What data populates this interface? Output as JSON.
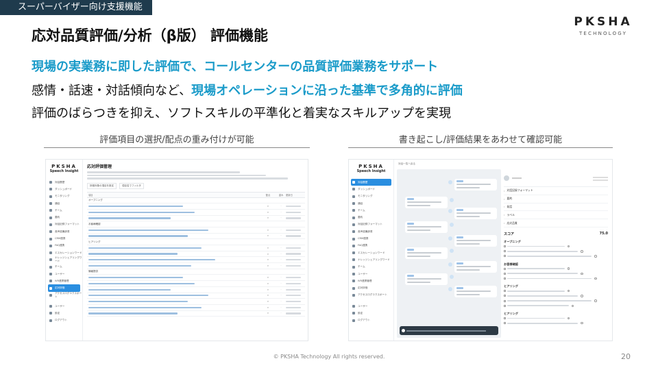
{
  "header": {
    "category_tag": "スーパーバイザー向け支援機能",
    "title": "応対品質評価/分析（β版） 評価機能",
    "logo_main": "PKSHA",
    "logo_sub": "TECHNOLOGY"
  },
  "body": {
    "line1": "現場の実業務に即した評価で、コールセンターの品質評価業務をサポート",
    "line2_prefix": "感情・話速・対話傾向など、",
    "line2_highlight": "現場オペレーションに沿った基準で多角的に評価",
    "line3": "評価のばらつきを抑え、ソフトスキルの平準化と着実なスキルアップを実現"
  },
  "captions": {
    "left": "評価項目の選択/配点の重み付けが可能",
    "right": "書き起こし/評価結果をあわせて確認可能"
  },
  "screenshot_left": {
    "logo": "PKSHA",
    "logo_sub": "Speech Insight",
    "page_title": "応対評価管理",
    "toolbar": [
      "評価対象の項目を設定",
      "項目名でフィルタ"
    ],
    "columns": [
      "項目",
      "配点",
      "重み",
      "更新日"
    ],
    "nav_items": [
      {
        "label": "対話履歴",
        "active": false
      },
      {
        "label": "ダッシュボード",
        "active": false
      },
      {
        "label": "モニタリング",
        "active": false
      },
      {
        "label": "通話",
        "active": false
      },
      {
        "label": "チーム",
        "active": false
      },
      {
        "label": "要約",
        "active": false
      },
      {
        "label": "対話記録フォーマット",
        "active": false
      },
      {
        "label": "音声認識辞書",
        "active": false
      },
      {
        "label": "CRM連携",
        "active": false
      },
      {
        "label": "FAQ連携",
        "active": false
      },
      {
        "label": "エスカレーションワード",
        "active": false
      },
      {
        "label": "ナレッジシェアリングワード",
        "active": false
      },
      {
        "label": "チーム",
        "active": false
      },
      {
        "label": "ユーザー",
        "active": false
      },
      {
        "label": "IVR連携管理",
        "active": false
      },
      {
        "label": "応対評価",
        "active": true
      },
      {
        "label": "アクセスログエクスポート",
        "active": false
      }
    ],
    "nav_bottom": [
      "ユーザー",
      "設定",
      "ログアウト"
    ],
    "sections": [
      {
        "name": "オープニング",
        "rows": 3
      },
      {
        "name": "お客様確認",
        "rows": 2
      },
      {
        "name": "ヒアリング",
        "rows": 4
      },
      {
        "name": "情報提供",
        "rows": 7
      }
    ]
  },
  "screenshot_right": {
    "logo": "PKSHA",
    "logo_sub": "Speech Insight",
    "breadcrumb": "対話一覧へ戻る",
    "nav_items": [
      {
        "label": "対話履歴",
        "active": true
      },
      {
        "label": "ダッシュボード",
        "active": false
      },
      {
        "label": "モニタリング",
        "active": false
      },
      {
        "label": "通話",
        "active": false
      },
      {
        "label": "チーム",
        "active": false
      },
      {
        "label": "要約",
        "active": false
      },
      {
        "label": "対話記録フォーマット",
        "active": false
      },
      {
        "label": "音声認識辞書",
        "active": false
      },
      {
        "label": "CRM連携",
        "active": false
      },
      {
        "label": "FAQ連携",
        "active": false
      },
      {
        "label": "エスカレーションワード",
        "active": false
      },
      {
        "label": "ナレッジシェアリングワード",
        "active": false
      },
      {
        "label": "チーム",
        "active": false
      },
      {
        "label": "ユーザー",
        "active": false
      },
      {
        "label": "IVR連携管理",
        "active": false
      },
      {
        "label": "応対評価",
        "active": false
      },
      {
        "label": "アクセスログエクスポート",
        "active": false
      }
    ],
    "nav_bottom": [
      "ユーザー",
      "設定",
      "ログアウト"
    ],
    "accordions": [
      "対話記録フォーマット",
      "要約",
      "発話",
      "ラベル",
      "応対品質"
    ],
    "score_label": "スコア",
    "score_value": "75.0",
    "eval_sections": [
      {
        "name": "オープニング",
        "items": 3
      },
      {
        "name": "お客様確認",
        "items": 3
      },
      {
        "name": "ヒアリング",
        "items": 4
      },
      {
        "name": "ヒアリング",
        "items": 2
      }
    ]
  },
  "footer": {
    "copyright": "© PKSHA Technology All rights reserved.",
    "page_number": "20"
  }
}
